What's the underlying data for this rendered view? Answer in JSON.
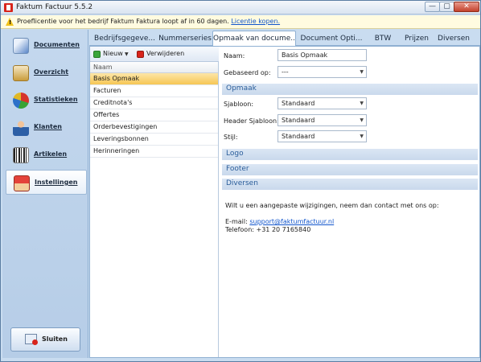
{
  "window": {
    "title": "Faktum Factuur 5.5.2",
    "controls": {
      "minimize": "—",
      "maximize": "▢",
      "close": "✕"
    }
  },
  "infobar": {
    "text": "Proeflicentie voor het bedrijf Faktum Faktura loopt af in 60 dagen.",
    "link": "Licentie kopen."
  },
  "sidebar": {
    "items": [
      {
        "label": "Documenten",
        "icon": "documents-icon"
      },
      {
        "label": "Overzicht",
        "icon": "overview-icon"
      },
      {
        "label": "Statistieken",
        "icon": "statistics-icon"
      },
      {
        "label": "Klanten",
        "icon": "customers-icon"
      },
      {
        "label": "Artikelen",
        "icon": "articles-icon"
      },
      {
        "label": "Instellingen",
        "icon": "settings-icon",
        "active": true
      }
    ],
    "close_button": "Sluiten"
  },
  "tabs": [
    {
      "label": "Bedrijfsgegeve..."
    },
    {
      "label": "Nummerseries"
    },
    {
      "label": "Opmaak van docume...",
      "active": true
    },
    {
      "label": "Document Opti..."
    },
    {
      "label": "BTW"
    },
    {
      "label": "Prijzen"
    },
    {
      "label": "Diversen"
    }
  ],
  "toolbar": {
    "new_label": "Nieuw",
    "delete_label": "Verwijderen"
  },
  "list": {
    "header": "Naam",
    "items": [
      "Basis Opmaak",
      "Facturen",
      "Creditnota's",
      "Offertes",
      "Orderbevestigingen",
      "Leveringsbonnen",
      "Herinneringen"
    ],
    "selected_index": 0
  },
  "form": {
    "name_label": "Naam:",
    "name_value": "Basis Opmaak",
    "based_on_label": "Gebaseerd op:",
    "based_on_value": "---",
    "sections": {
      "opmaak": "Opmaak",
      "logo": "Logo",
      "footer": "Footer",
      "diversen": "Diversen"
    },
    "template_label": "Sjabloon:",
    "template_value": "Standaard",
    "header_template_label": "Header Sjabloon:",
    "header_template_value": "Standaard",
    "style_label": "Stijl:",
    "style_value": "Standaard",
    "contact_text": "Wilt u een aangepaste wijzigingen, neem dan contact met ons op:",
    "email_label": "E-mail:",
    "email_value": "support@faktumfactuur.nl",
    "phone_label": "Telefoon:",
    "phone_value": "+31 20 7165840"
  },
  "colors": {
    "selection": "#f6c654",
    "accent": "#2a5d9a",
    "sidebar": "#c4d8ee"
  }
}
